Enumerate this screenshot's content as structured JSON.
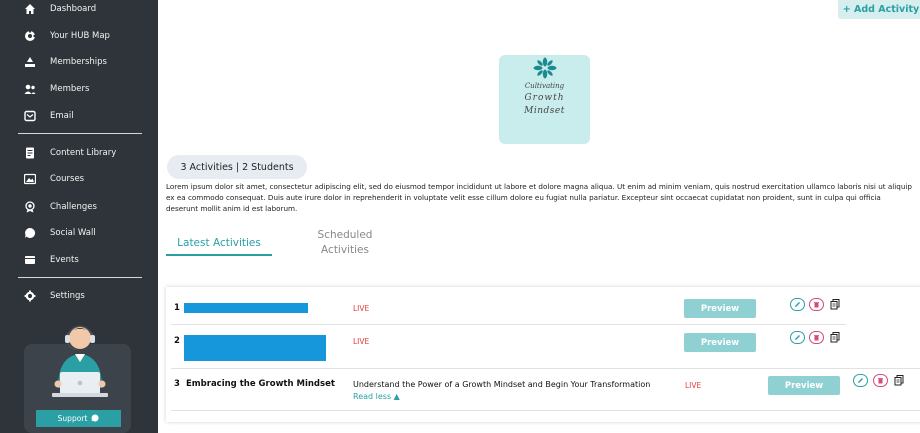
{
  "sidebar": {
    "items": [
      {
        "label": "Dashboard",
        "icon": "home-icon"
      },
      {
        "label": "Your HUB Map",
        "icon": "hub-map-icon"
      },
      {
        "label": "Memberships",
        "icon": "memberships-icon"
      },
      {
        "label": "Members",
        "icon": "members-icon"
      },
      {
        "label": "Email",
        "icon": "email-icon"
      },
      {
        "label": "Content Library",
        "icon": "content-library-icon"
      },
      {
        "label": "Courses",
        "icon": "courses-icon"
      },
      {
        "label": "Challenges",
        "icon": "challenges-icon"
      },
      {
        "label": "Social Wall",
        "icon": "social-wall-icon"
      },
      {
        "label": "Events",
        "icon": "events-icon"
      },
      {
        "label": "Settings",
        "icon": "settings-icon"
      }
    ],
    "support_label": "Support"
  },
  "header": {
    "add_activity_label": "+ Add Activity"
  },
  "logo": {
    "line1": "Cultivating",
    "line2": "Growth",
    "line3": "Mindset"
  },
  "summary": {
    "count_text": "3 Activities | 2 Students"
  },
  "description": "Lorem ipsum dolor sit amet, consectetur adipiscing elit, sed do eiusmod tempor incididunt ut labore et dolore magna aliqua. Ut enim ad minim veniam, quis nostrud exercitation ullamco laboris nisi ut aliquip ex ea commodo consequat. Duis aute irure dolor in reprehenderit in voluptate velit esse cillum dolore eu fugiat nulla pariatur. Excepteur sint occaecat cupidatat non proident, sunt in culpa qui officia deserunt mollit anim id est laborum.",
  "tabs": {
    "latest": "Latest Activities",
    "scheduled": "Scheduled Activities"
  },
  "activities": [
    {
      "num": "1",
      "title": "",
      "status": "LIVE",
      "preview": "Preview"
    },
    {
      "num": "2",
      "title": "",
      "status": "LIVE",
      "preview": "Preview"
    },
    {
      "num": "3",
      "title": "Embracing the Growth Mindset",
      "description": "Understand the Power of a Growth Mindset and Begin Your Transformation",
      "read_less": "Read less ▲",
      "status": "LIVE",
      "preview": "Preview"
    }
  ],
  "colors": {
    "accent": "#2aa0a4",
    "sidebar_bg": "#2f343a",
    "live": "#e0403f",
    "preview_bg": "#8fd0d2",
    "delete": "#d44a7a"
  }
}
